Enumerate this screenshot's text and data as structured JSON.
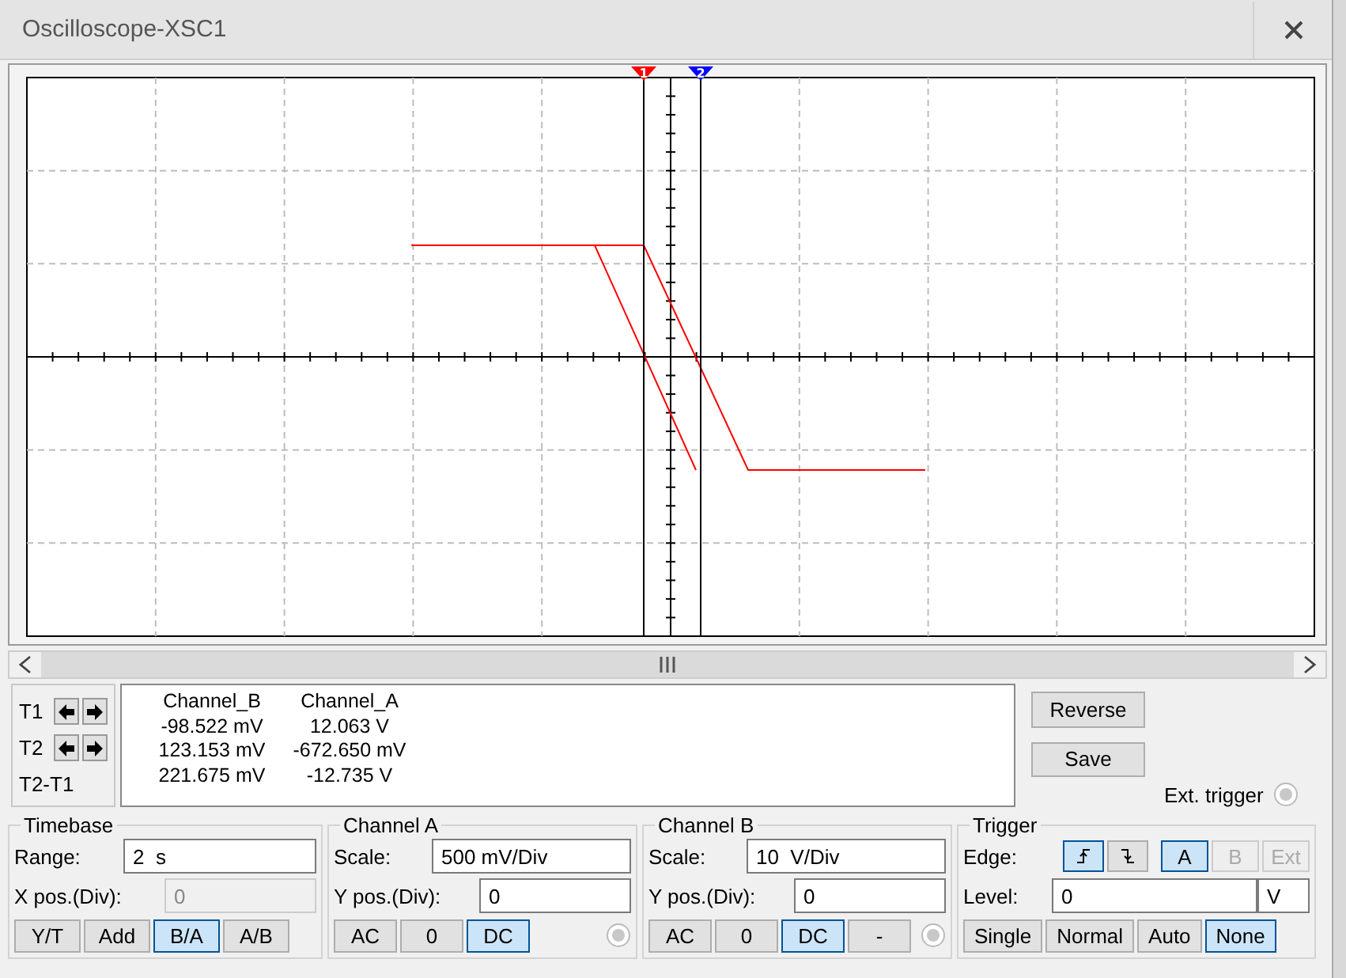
{
  "window": {
    "title": "Oscilloscope-XSC1"
  },
  "plot": {
    "cursors": [
      {
        "label": "1",
        "color": "#ff0000"
      },
      {
        "label": "2",
        "color": "#0000ff"
      }
    ]
  },
  "readout": {
    "cursor_rows": [
      {
        "label": "T1",
        "arrows": true
      },
      {
        "label": "T2",
        "arrows": true
      },
      {
        "label": "T2-T1",
        "arrows": false
      }
    ],
    "columns": [
      "Channel_B",
      "Channel_A"
    ],
    "rows": [
      [
        "-98.522 mV",
        "12.063 V"
      ],
      [
        "123.153 mV",
        "-672.650 mV"
      ],
      [
        "221.675 mV",
        "-12.735 V"
      ]
    ]
  },
  "side_buttons": [
    "Reverse",
    "Save"
  ],
  "ext_trigger": {
    "label": "Ext. trigger"
  },
  "timebase": {
    "title": "Timebase",
    "fields": [
      {
        "label": "Range:",
        "value": "2  s",
        "disabled": false
      },
      {
        "label": "X pos.(Div):",
        "value": "0",
        "disabled": true
      }
    ],
    "modes": [
      {
        "label": "Y/T",
        "selected": false
      },
      {
        "label": "Add",
        "selected": false
      },
      {
        "label": "B/A",
        "selected": true
      },
      {
        "label": "A/B",
        "selected": false
      }
    ]
  },
  "channels": [
    {
      "title": "Channel A",
      "fields": [
        {
          "label": "Scale:",
          "value": "500 mV/Div",
          "disabled": false
        },
        {
          "label": "Y pos.(Div):",
          "value": "0",
          "disabled": false
        }
      ],
      "coupling": [
        {
          "label": "AC",
          "selected": false
        },
        {
          "label": "0",
          "selected": false
        },
        {
          "label": "DC",
          "selected": true
        }
      ]
    },
    {
      "title": "Channel B",
      "fields": [
        {
          "label": "Scale:",
          "value": "10  V/Div",
          "disabled": false
        },
        {
          "label": "Y pos.(Div):",
          "value": "0",
          "disabled": false
        }
      ],
      "coupling": [
        {
          "label": "AC",
          "selected": false
        },
        {
          "label": "0",
          "selected": false
        },
        {
          "label": "DC",
          "selected": true
        },
        {
          "label": "-",
          "selected": false
        }
      ]
    }
  ],
  "trigger": {
    "title": "Trigger",
    "edge_label": "Edge:",
    "edges": [
      {
        "kind": "rising",
        "selected": true
      },
      {
        "kind": "falling",
        "selected": false
      }
    ],
    "sources": [
      {
        "label": "A",
        "selected": true,
        "disabled": false
      },
      {
        "label": "B",
        "selected": false,
        "disabled": true
      },
      {
        "label": "Ext",
        "selected": false,
        "disabled": true
      }
    ],
    "level_label": "Level:",
    "level_value": "0",
    "level_unit": "V",
    "modes": [
      {
        "label": "Single",
        "selected": false
      },
      {
        "label": "Normal",
        "selected": false
      },
      {
        "label": "Auto",
        "selected": false
      },
      {
        "label": "None",
        "selected": true
      }
    ]
  }
}
